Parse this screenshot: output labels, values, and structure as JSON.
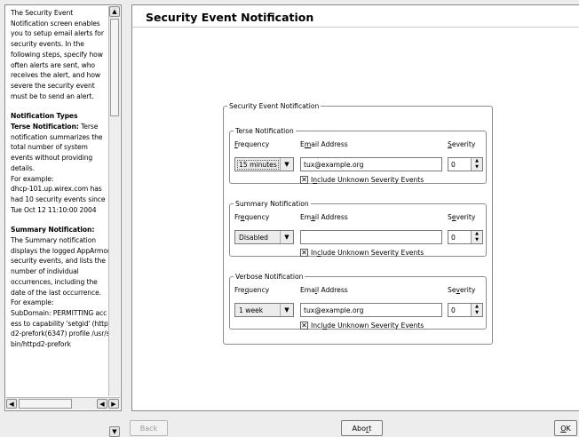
{
  "help": {
    "intro": "The Security Event Notification screen enables you to setup email alerts for security events. In the following steps, specify how often alerts are sent, who receives the alert, and how severe the security event must be to send an alert.",
    "types_heading": "Notification Types",
    "terse_heading": "Terse Notification:",
    "terse_text": " Terse notification summarizes the total number of system events without providing details.",
    "terse_example_label": "For example:",
    "terse_example": "dhcp-101.up.wirex.com has had 10 security events since Tue Oct 12 11:10:00 2004",
    "summary_heading": "Summary Notification:",
    "summary_text": "The Summary notification displays the logged AppArmor security events, and lists the number of individual occurrences, including the date of the last occurrence.",
    "summary_example_label": "For example:",
    "summary_example": "SubDomain: PERMITTING access to capability 'setgid' (httpd2-prefork(6347) profile /usr/sbin/httpd2-prefork"
  },
  "main": {
    "title": "Security Event Notification",
    "outer_legend": "Security Event Notification",
    "labels": {
      "frequency": "Frequency",
      "email": "Email Address",
      "severity": "Severity",
      "include_unknown": "Include Unknown Severity Events"
    },
    "groups": [
      {
        "legend": "Terse Notification",
        "frequency": "15 minutes",
        "email": "tux@example.org",
        "severity": "0",
        "include_unknown": true
      },
      {
        "legend": "Summary Notification",
        "frequency": "Disabled",
        "email": "",
        "severity": "0",
        "include_unknown": true
      },
      {
        "legend": "Verbose Notification",
        "frequency": "1 week",
        "email": "tux@example.org",
        "severity": "0",
        "include_unknown": true
      }
    ]
  },
  "buttons": {
    "back": "Back",
    "abort": "Abort",
    "ok": "OK"
  }
}
